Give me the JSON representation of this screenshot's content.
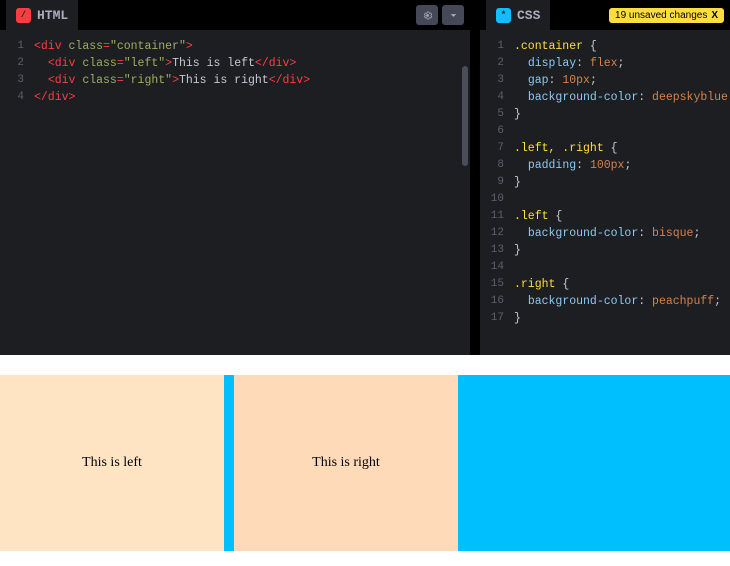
{
  "panels": {
    "html": {
      "label": "HTML"
    },
    "css": {
      "label": "CSS",
      "unsaved": "19 unsaved changes",
      "unsaved_close": "X"
    }
  },
  "html_lines": [
    "1",
    "2",
    "3",
    "4"
  ],
  "css_lines": [
    "1",
    "2",
    "3",
    "4",
    "5",
    "6",
    "7",
    "8",
    "9",
    "10",
    "11",
    "12",
    "13",
    "14",
    "15",
    "16",
    "17"
  ],
  "html_code": {
    "l1": {
      "t1": "<div ",
      "attr": "class",
      "eq": "=",
      "val": "\"container\"",
      "t2": ">"
    },
    "l2": {
      "indent": "  ",
      "t1": "<div ",
      "attr": "class",
      "eq": "=",
      "val": "\"left\"",
      "t2": ">",
      "text": "This is left",
      "close": "</div>"
    },
    "l3": {
      "indent": "  ",
      "t1": "<div ",
      "attr": "class",
      "eq": "=",
      "val": "\"right\"",
      "t2": ">",
      "text": "This is right",
      "close": "</div>"
    },
    "l4": {
      "close": "</div>"
    }
  },
  "css_code": {
    "l1": {
      "sel": ".container ",
      "brace": "{"
    },
    "l2": {
      "indent": "  ",
      "prop": "display",
      "colon": ": ",
      "val": "flex",
      "semi": ";"
    },
    "l3": {
      "indent": "  ",
      "prop": "gap",
      "colon": ": ",
      "val": "10px",
      "semi": ";"
    },
    "l4": {
      "indent": "  ",
      "prop": "background-color",
      "colon": ": ",
      "val": "deepskyblue",
      "semi": ";"
    },
    "l5": {
      "brace": "}"
    },
    "l6": {
      "blank": " "
    },
    "l7": {
      "sel": ".left, .right ",
      "brace": "{"
    },
    "l8": {
      "indent": "  ",
      "prop": "padding",
      "colon": ": ",
      "val": "100px",
      "semi": ";"
    },
    "l9": {
      "brace": "}"
    },
    "l10": {
      "blank": " "
    },
    "l11": {
      "sel": ".left ",
      "brace": "{"
    },
    "l12": {
      "indent": "  ",
      "prop": "background-color",
      "colon": ": ",
      "val": "bisque",
      "semi": ";"
    },
    "l13": {
      "brace": "}"
    },
    "l14": {
      "blank": " "
    },
    "l15": {
      "sel": ".right ",
      "brace": "{"
    },
    "l16": {
      "indent": "  ",
      "prop": "background-color",
      "colon": ": ",
      "val": "peachpuff",
      "semi": ";"
    },
    "l17": {
      "brace": "}"
    }
  },
  "preview": {
    "left_text": "This is left",
    "right_text": "This is right"
  }
}
